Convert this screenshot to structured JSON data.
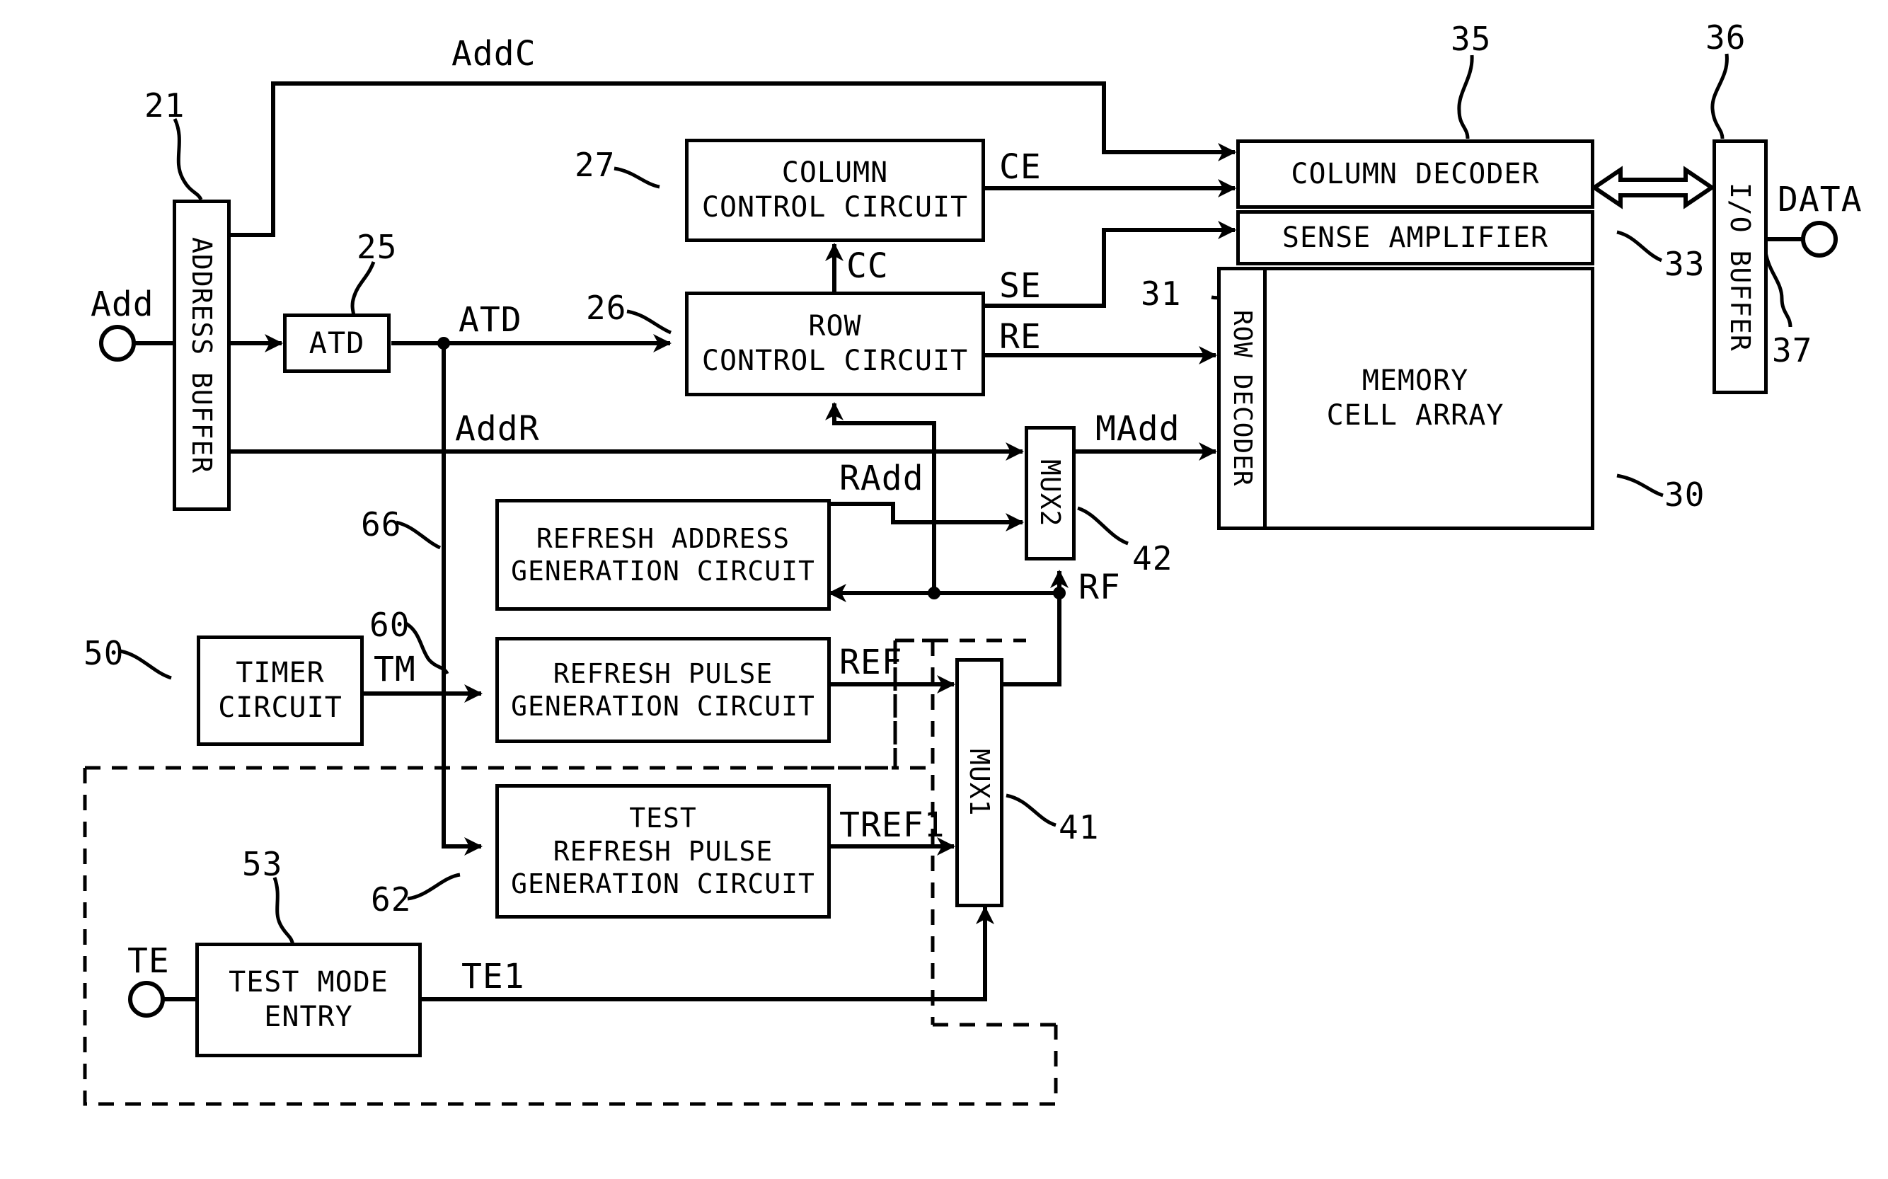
{
  "figure": {
    "kind": "patent-block-diagram",
    "title": "",
    "line_color": "#000000",
    "background": "#ffffff"
  },
  "blocks": [
    {
      "id": "address_buffer",
      "label": "ADDRESS BUFFER",
      "ref": "21",
      "orientation": "vertical"
    },
    {
      "id": "atd",
      "label": "ATD",
      "ref": "25",
      "orientation": "horizontal"
    },
    {
      "id": "column_control",
      "label": "COLUMN\nCONTROL CIRCUIT",
      "ref": "27",
      "orientation": "horizontal"
    },
    {
      "id": "row_control",
      "label": "ROW\nCONTROL CIRCUIT",
      "ref": "26",
      "orientation": "horizontal"
    },
    {
      "id": "column_decoder",
      "label": "COLUMN DECODER",
      "ref": "35",
      "orientation": "horizontal"
    },
    {
      "id": "sense_amplifier",
      "label": "SENSE AMPLIFIER",
      "ref": "33",
      "orientation": "horizontal"
    },
    {
      "id": "memory_array",
      "label": "MEMORY\nCELL ARRAY",
      "ref": "30",
      "orientation": "horizontal"
    },
    {
      "id": "row_decoder",
      "label": "ROW DECODER",
      "ref": "31",
      "orientation": "vertical"
    },
    {
      "id": "io_buffer",
      "label": "I/O BUFFER",
      "ref": "36",
      "orientation": "vertical"
    },
    {
      "id": "refresh_addr",
      "label": "REFRESH ADDRESS\nGENERATION CIRCUIT",
      "ref": "66",
      "orientation": "horizontal"
    },
    {
      "id": "refresh_pulse",
      "label": "REFRESH PULSE\nGENERATION CIRCUIT",
      "ref": "60",
      "orientation": "horizontal"
    },
    {
      "id": "test_refresh",
      "label": "TEST\nREFRESH PULSE\nGENERATION CIRCUIT",
      "ref": "62",
      "orientation": "horizontal"
    },
    {
      "id": "timer_circuit",
      "label": "TIMER\nCIRCUIT",
      "ref": "50",
      "orientation": "horizontal"
    },
    {
      "id": "test_mode_entry",
      "label": "TEST MODE\nENTRY",
      "ref": "53",
      "orientation": "horizontal"
    },
    {
      "id": "mux1",
      "label": "MUX1",
      "ref": "41",
      "orientation": "vertical"
    },
    {
      "id": "mux2",
      "label": "MUX2",
      "ref": "42",
      "orientation": "vertical"
    }
  ],
  "block_labels": {
    "address_buffer": "ADDRESS BUFFER",
    "atd": "ATD",
    "column_control_line1": "COLUMN",
    "column_control_line2": "CONTROL CIRCUIT",
    "row_control_line1": "ROW",
    "row_control_line2": "CONTROL CIRCUIT",
    "column_decoder": "COLUMN DECODER",
    "sense_amplifier": "SENSE AMPLIFIER",
    "memory_array_line1": "MEMORY",
    "memory_array_line2": "CELL ARRAY",
    "row_decoder": "ROW DECODER",
    "io_buffer": "I/O BUFFER",
    "refresh_addr_line1": "REFRESH ADDRESS",
    "refresh_addr_line2": "GENERATION CIRCUIT",
    "refresh_pulse_line1": "REFRESH PULSE",
    "refresh_pulse_line2": "GENERATION CIRCUIT",
    "test_refresh_line1": "TEST",
    "test_refresh_line2": "REFRESH PULSE",
    "test_refresh_line3": "GENERATION CIRCUIT",
    "timer_line1": "TIMER",
    "timer_line2": "CIRCUIT",
    "test_mode_line1": "TEST MODE",
    "test_mode_line2": "ENTRY",
    "mux1": "MUX1",
    "mux2": "MUX2"
  },
  "reference_numerals": {
    "n21": "21",
    "n25": "25",
    "n26": "26",
    "n27": "27",
    "n30": "30",
    "n31": "31",
    "n33": "33",
    "n35": "35",
    "n36": "36",
    "n37": "37",
    "n41": "41",
    "n42": "42",
    "n50": "50",
    "n53": "53",
    "n60": "60",
    "n62": "62",
    "n66": "66"
  },
  "signals": {
    "add": "Add",
    "addc": "AddC",
    "addr": "AddR",
    "atd": "ATD",
    "cc": "CC",
    "ce": "CE",
    "se": "SE",
    "re": "RE",
    "madd": "MAdd",
    "radd": "RAdd",
    "rf": "RF",
    "ref": "REF",
    "tref1": "TREF1",
    "tm": "TM",
    "te": "TE",
    "te1": "TE1",
    "data": "DATA"
  }
}
